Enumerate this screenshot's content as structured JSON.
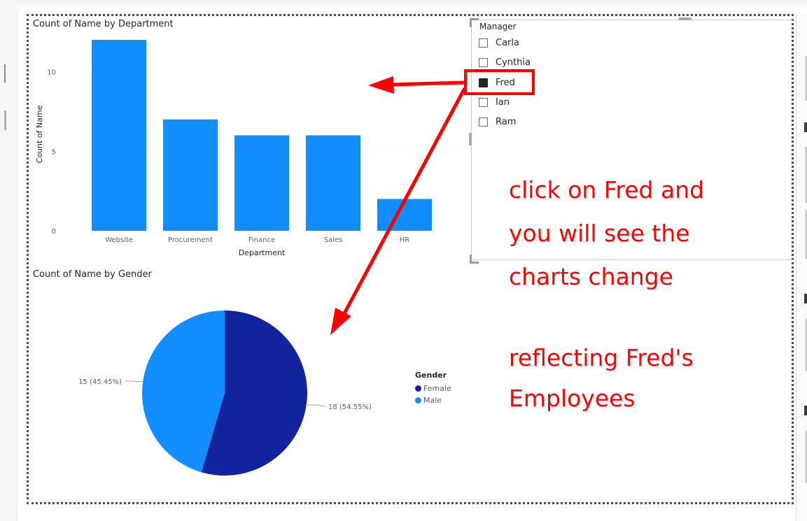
{
  "bar_visual": {
    "title": "Count of Name by Department"
  },
  "pie_visual": {
    "title": "Count of Name by Gender",
    "labels": [
      "15 (45.45%)",
      "18 (54.55%)"
    ],
    "legend_title": "Gender",
    "legend_items": [
      "Female",
      "Male"
    ]
  },
  "slicer": {
    "title": "Manager",
    "items": [
      {
        "label": "Carla",
        "checked": false
      },
      {
        "label": "Cynthia",
        "checked": false
      },
      {
        "label": "Fred",
        "checked": true
      },
      {
        "label": "Ian",
        "checked": false
      },
      {
        "label": "Ram",
        "checked": false
      }
    ]
  },
  "annotation": {
    "lines": [
      "click on Fred and",
      "you will see the",
      "charts change",
      "",
      "reflecting Fred's",
      "Employees"
    ]
  },
  "colors": {
    "bar": "#118dff",
    "female": "#12239e",
    "male": "#118dff",
    "annotation_red": "#ff0000"
  },
  "chart_data": [
    {
      "type": "bar",
      "title": "Count of Name by Department",
      "xlabel": "Department",
      "ylabel": "Count of Name",
      "categories": [
        "Website",
        "Procurement",
        "Finance",
        "Sales",
        "HR"
      ],
      "values": [
        12,
        7,
        6,
        6,
        2
      ],
      "ylim": [
        0,
        12
      ],
      "yticks": [
        "0",
        "5",
        "10"
      ],
      "grid": true
    },
    {
      "type": "pie",
      "title": "Count of Name by Gender",
      "categories": [
        "Female",
        "Male"
      ],
      "values": [
        18,
        15
      ],
      "percent": [
        54.55,
        45.45
      ],
      "legend_title": "Gender",
      "legend": "right"
    }
  ]
}
